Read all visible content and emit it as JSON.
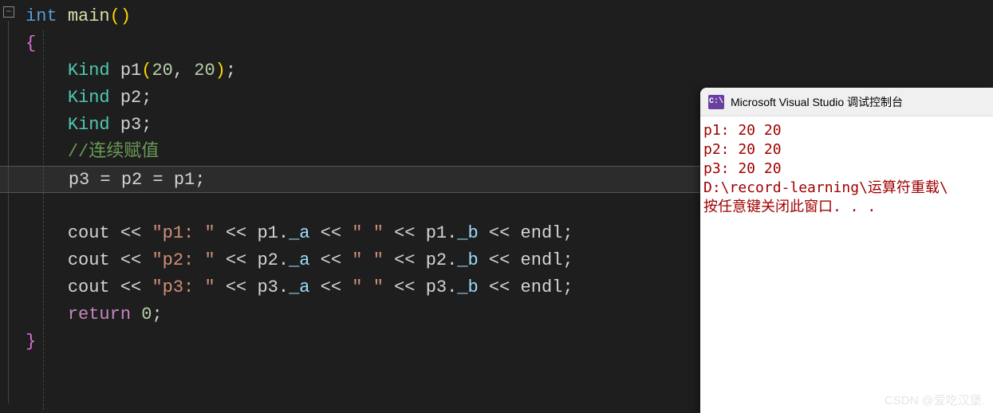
{
  "code": {
    "line1": {
      "int": "int",
      "main": "main",
      "lparen": "(",
      "rparen": ")"
    },
    "line2": {
      "brace": "{"
    },
    "line3": {
      "kind": "Kind",
      "var": "p1",
      "lparen": "(",
      "n1": "20",
      "comma": ", ",
      "n2": "20",
      "rparen": ")",
      "semi": ";"
    },
    "line4": {
      "kind": "Kind",
      "var": "p2",
      "semi": ";"
    },
    "line5": {
      "kind": "Kind",
      "var": "p3",
      "semi": ";"
    },
    "line6": {
      "comment": "//连续赋值"
    },
    "line7": {
      "p3": "p3",
      "eq1": " = ",
      "p2": "p2",
      "eq2": " = ",
      "p1": "p1",
      "semi": ";"
    },
    "line9": {
      "cout": "cout",
      "op1": " << ",
      "str1": "\"p1: \"",
      "op2": " << ",
      "v1": "p1",
      "dot1": ".",
      "m1": "_a",
      "op3": " << ",
      "str2": "\" \"",
      "op4": " << ",
      "v2": "p1",
      "dot2": ".",
      "m2": "_b",
      "op5": " << ",
      "endl": "endl",
      "semi": ";"
    },
    "line10": {
      "cout": "cout",
      "op1": " << ",
      "str1": "\"p2: \"",
      "op2": " << ",
      "v1": "p2",
      "dot1": ".",
      "m1": "_a",
      "op3": " << ",
      "str2": "\" \"",
      "op4": " << ",
      "v2": "p2",
      "dot2": ".",
      "m2": "_b",
      "op5": " << ",
      "endl": "endl",
      "semi": ";"
    },
    "line11": {
      "cout": "cout",
      "op1": " << ",
      "str1": "\"p3: \"",
      "op2": " << ",
      "v1": "p3",
      "dot1": ".",
      "m1": "_a",
      "op3": " << ",
      "str2": "\" \"",
      "op4": " << ",
      "v2": "p3",
      "dot2": ".",
      "m2": "_b",
      "op5": " << ",
      "endl": "endl",
      "semi": ";"
    },
    "line12": {
      "return": "return",
      "zero": "0",
      "semi": ";"
    },
    "line13": {
      "brace": "}"
    }
  },
  "console": {
    "icon": "C:\\",
    "title": "Microsoft Visual Studio 调试控制台",
    "out1": "p1: 20 20",
    "out2": "p2: 20 20",
    "out3": "p3: 20 20",
    "out4": "",
    "out5": "D:\\record-learning\\运算符重载\\",
    "out6": "按任意键关闭此窗口. . ."
  },
  "fold_icon": "−",
  "watermark": "CSDN @爱吃汉堡."
}
